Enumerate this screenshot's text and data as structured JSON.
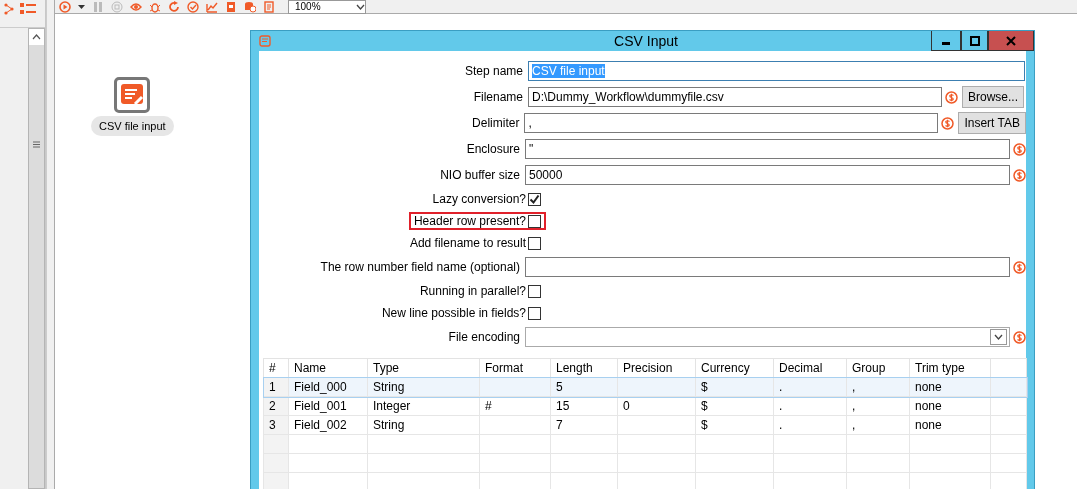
{
  "toolbar": {
    "buttons": [
      {
        "kind": "run",
        "disabled": false
      },
      {
        "kind": "caret",
        "disabled": false
      },
      {
        "kind": "pause",
        "disabled": true
      },
      {
        "kind": "stop",
        "disabled": true
      },
      {
        "kind": "preview",
        "disabled": false
      },
      {
        "kind": "debug",
        "disabled": false
      },
      {
        "kind": "replay",
        "disabled": false
      },
      {
        "kind": "verify",
        "disabled": false
      },
      {
        "kind": "impact",
        "disabled": false
      },
      {
        "kind": "sql",
        "disabled": false
      },
      {
        "kind": "database",
        "disabled": false
      },
      {
        "kind": "notes",
        "disabled": false
      }
    ],
    "zoom": "100%"
  },
  "canvas": {
    "step": {
      "label": "CSV file input"
    }
  },
  "dialog": {
    "title": "CSV Input",
    "fields": [
      {
        "kind": "text",
        "label": "Step name",
        "value": "CSV file input",
        "value_selected": true,
        "variables": false
      },
      {
        "kind": "text",
        "label": "Filename",
        "value": "D:\\Dummy_Workflow\\dummyfile.csv",
        "variables": true,
        "button": "Browse..."
      },
      {
        "kind": "text",
        "label": "Delimiter",
        "value": ",",
        "variables": true,
        "button": "Insert TAB"
      },
      {
        "kind": "text",
        "label": "Enclosure",
        "value": "\"",
        "variables": true
      },
      {
        "kind": "text",
        "label": "NIO buffer size",
        "value": "50000",
        "variables": true
      },
      {
        "kind": "checkbox",
        "label": "Lazy conversion?",
        "checked": true,
        "highlighted": false
      },
      {
        "kind": "checkbox",
        "label": "Header row present?",
        "checked": false,
        "highlighted": true
      },
      {
        "kind": "checkbox",
        "label": "Add filename to result",
        "checked": false,
        "highlighted": false
      },
      {
        "kind": "text",
        "label": "The row number field name (optional)",
        "variables": true
      },
      {
        "kind": "checkbox",
        "label": "Running in parallel?",
        "checked": false,
        "highlighted": false
      },
      {
        "kind": "checkbox",
        "label": "New line possible in fields?",
        "checked": false,
        "highlighted": false
      },
      {
        "kind": "combo",
        "label": "File encoding",
        "variables": true
      }
    ],
    "table": {
      "columns": [
        "#",
        "Name",
        "Type",
        "Format",
        "Length",
        "Precision",
        "Currency",
        "Decimal",
        "Group",
        "Trim type"
      ],
      "rows": [
        {
          "selected": true,
          "cells": [
            "1",
            "Field_000",
            "String",
            "",
            "5",
            "",
            "$",
            ".",
            ",",
            "none"
          ]
        },
        {
          "selected": false,
          "cells": [
            "2",
            "Field_001",
            "Integer",
            "#",
            "15",
            "0",
            "$",
            ".",
            ",",
            "none"
          ]
        },
        {
          "selected": false,
          "cells": [
            "3",
            "Field_002",
            "String",
            "",
            "7",
            "",
            "$",
            ".",
            ",",
            "none"
          ]
        }
      ]
    }
  }
}
